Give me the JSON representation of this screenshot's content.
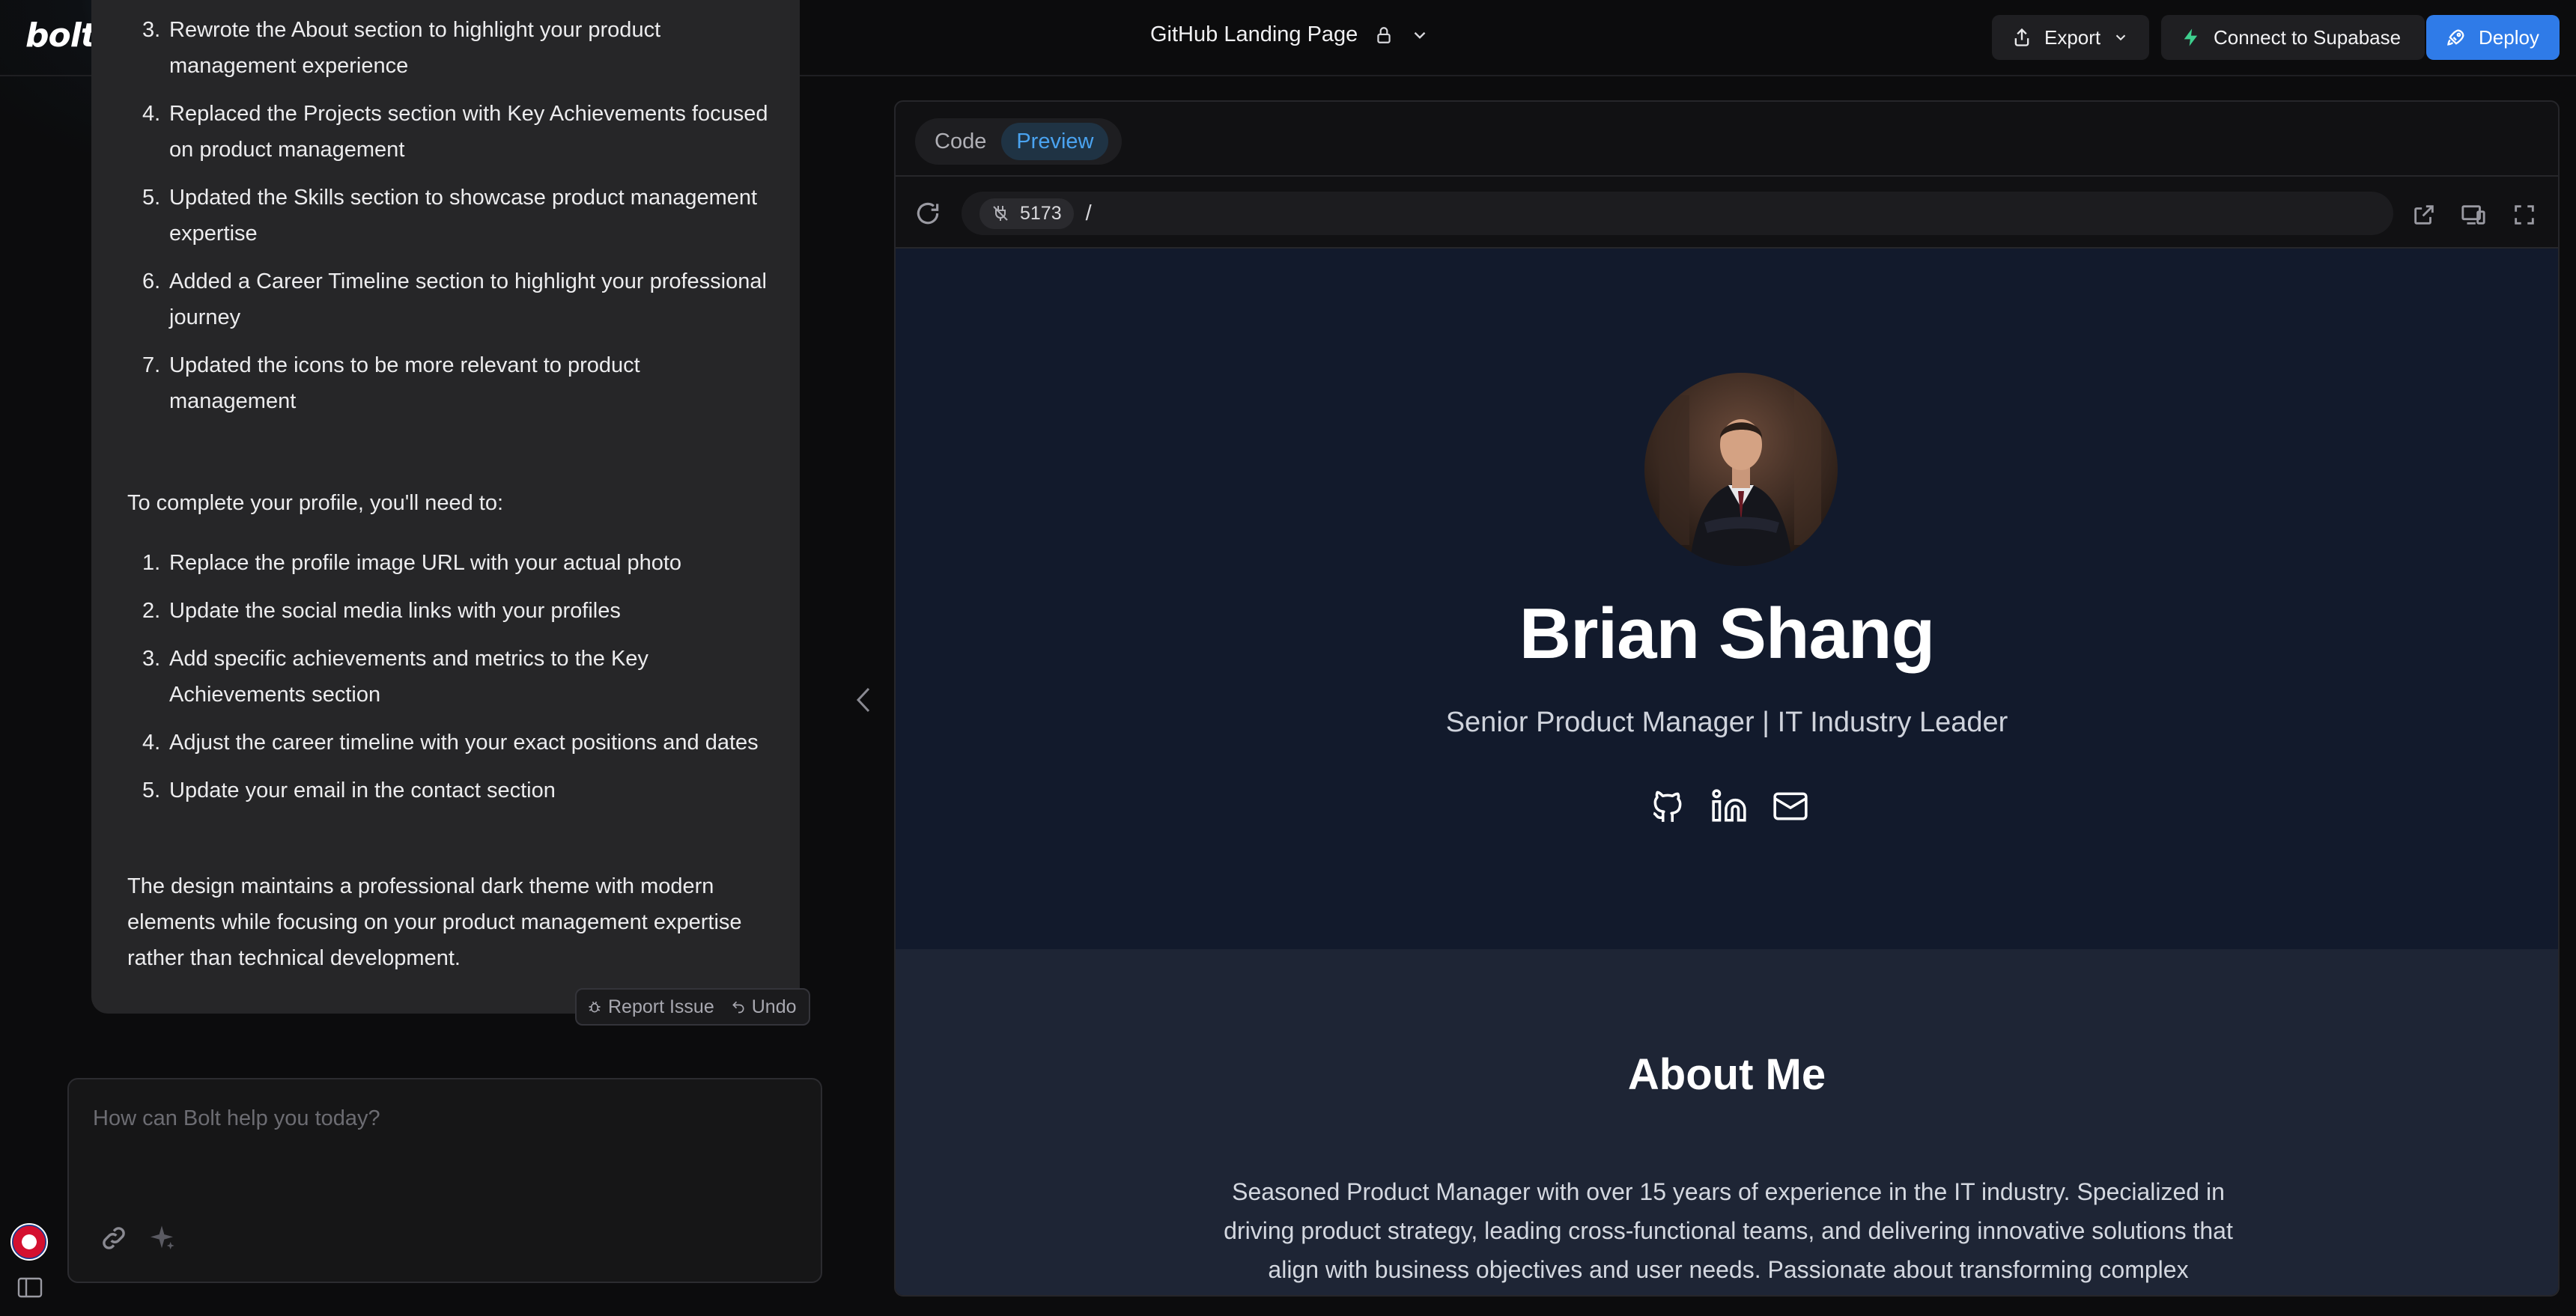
{
  "app": {
    "logo": "bolt"
  },
  "header": {
    "project_title": "GitHub Landing Page",
    "export_label": "Export",
    "supabase_label": "Connect to Supabase",
    "deploy_label": "Deploy",
    "accent_color": "#2f7be8"
  },
  "chat": {
    "list1": [
      {
        "num": "3.",
        "text": "Rewrote the About section to highlight your product management experience"
      },
      {
        "num": "4.",
        "text": "Replaced the Projects section with Key Achievements focused on product management"
      },
      {
        "num": "5.",
        "text": "Updated the Skills section to showcase product management expertise"
      },
      {
        "num": "6.",
        "text": "Added a Career Timeline section to highlight your professional journey"
      },
      {
        "num": "7.",
        "text": "Updated the icons to be more relevant to product management"
      }
    ],
    "para1": "To complete your profile, you'll need to:",
    "list2": [
      {
        "num": "1.",
        "text": "Replace the profile image URL with your actual photo"
      },
      {
        "num": "2.",
        "text": "Update the social media links with your profiles"
      },
      {
        "num": "3.",
        "text": "Add specific achievements and metrics to the Key Achievements section"
      },
      {
        "num": "4.",
        "text": "Adjust the career timeline with your exact positions and dates"
      },
      {
        "num": "5.",
        "text": "Update your email in the contact section"
      }
    ],
    "para2": "The design maintains a professional dark theme with modern elements while focusing on your product management expertise rather than technical development.",
    "report_label": "Report Issue",
    "undo_label": "Undo",
    "prompt_placeholder": "How can Bolt help you today?"
  },
  "preview": {
    "tabs": [
      {
        "label": "Code"
      },
      {
        "label": "Preview"
      }
    ],
    "active_tab": "Preview",
    "port": "5173",
    "path": "/",
    "site": {
      "name": "Brian Shang",
      "role": "Senior Product Manager | IT Industry Leader",
      "socials": [
        "github-icon",
        "linkedin-icon",
        "mail-icon"
      ],
      "about_title": "About Me",
      "about_text": "Seasoned Product Manager with over 15 years of experience in the IT industry. Specialized in driving product strategy, leading cross-functional teams, and delivering innovative solutions that align with business objectives and user needs. Passionate about transforming complex"
    }
  }
}
